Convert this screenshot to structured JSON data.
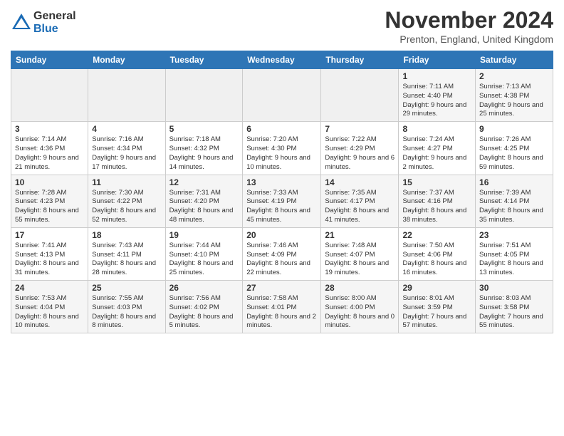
{
  "logo": {
    "general": "General",
    "blue": "Blue"
  },
  "header": {
    "month": "November 2024",
    "location": "Prenton, England, United Kingdom"
  },
  "days_of_week": [
    "Sunday",
    "Monday",
    "Tuesday",
    "Wednesday",
    "Thursday",
    "Friday",
    "Saturday"
  ],
  "weeks": [
    [
      {
        "day": "",
        "info": ""
      },
      {
        "day": "",
        "info": ""
      },
      {
        "day": "",
        "info": ""
      },
      {
        "day": "",
        "info": ""
      },
      {
        "day": "",
        "info": ""
      },
      {
        "day": "1",
        "info": "Sunrise: 7:11 AM\nSunset: 4:40 PM\nDaylight: 9 hours and 29 minutes."
      },
      {
        "day": "2",
        "info": "Sunrise: 7:13 AM\nSunset: 4:38 PM\nDaylight: 9 hours and 25 minutes."
      }
    ],
    [
      {
        "day": "3",
        "info": "Sunrise: 7:14 AM\nSunset: 4:36 PM\nDaylight: 9 hours and 21 minutes."
      },
      {
        "day": "4",
        "info": "Sunrise: 7:16 AM\nSunset: 4:34 PM\nDaylight: 9 hours and 17 minutes."
      },
      {
        "day": "5",
        "info": "Sunrise: 7:18 AM\nSunset: 4:32 PM\nDaylight: 9 hours and 14 minutes."
      },
      {
        "day": "6",
        "info": "Sunrise: 7:20 AM\nSunset: 4:30 PM\nDaylight: 9 hours and 10 minutes."
      },
      {
        "day": "7",
        "info": "Sunrise: 7:22 AM\nSunset: 4:29 PM\nDaylight: 9 hours and 6 minutes."
      },
      {
        "day": "8",
        "info": "Sunrise: 7:24 AM\nSunset: 4:27 PM\nDaylight: 9 hours and 2 minutes."
      },
      {
        "day": "9",
        "info": "Sunrise: 7:26 AM\nSunset: 4:25 PM\nDaylight: 8 hours and 59 minutes."
      }
    ],
    [
      {
        "day": "10",
        "info": "Sunrise: 7:28 AM\nSunset: 4:23 PM\nDaylight: 8 hours and 55 minutes."
      },
      {
        "day": "11",
        "info": "Sunrise: 7:30 AM\nSunset: 4:22 PM\nDaylight: 8 hours and 52 minutes."
      },
      {
        "day": "12",
        "info": "Sunrise: 7:31 AM\nSunset: 4:20 PM\nDaylight: 8 hours and 48 minutes."
      },
      {
        "day": "13",
        "info": "Sunrise: 7:33 AM\nSunset: 4:19 PM\nDaylight: 8 hours and 45 minutes."
      },
      {
        "day": "14",
        "info": "Sunrise: 7:35 AM\nSunset: 4:17 PM\nDaylight: 8 hours and 41 minutes."
      },
      {
        "day": "15",
        "info": "Sunrise: 7:37 AM\nSunset: 4:16 PM\nDaylight: 8 hours and 38 minutes."
      },
      {
        "day": "16",
        "info": "Sunrise: 7:39 AM\nSunset: 4:14 PM\nDaylight: 8 hours and 35 minutes."
      }
    ],
    [
      {
        "day": "17",
        "info": "Sunrise: 7:41 AM\nSunset: 4:13 PM\nDaylight: 8 hours and 31 minutes."
      },
      {
        "day": "18",
        "info": "Sunrise: 7:43 AM\nSunset: 4:11 PM\nDaylight: 8 hours and 28 minutes."
      },
      {
        "day": "19",
        "info": "Sunrise: 7:44 AM\nSunset: 4:10 PM\nDaylight: 8 hours and 25 minutes."
      },
      {
        "day": "20",
        "info": "Sunrise: 7:46 AM\nSunset: 4:09 PM\nDaylight: 8 hours and 22 minutes."
      },
      {
        "day": "21",
        "info": "Sunrise: 7:48 AM\nSunset: 4:07 PM\nDaylight: 8 hours and 19 minutes."
      },
      {
        "day": "22",
        "info": "Sunrise: 7:50 AM\nSunset: 4:06 PM\nDaylight: 8 hours and 16 minutes."
      },
      {
        "day": "23",
        "info": "Sunrise: 7:51 AM\nSunset: 4:05 PM\nDaylight: 8 hours and 13 minutes."
      }
    ],
    [
      {
        "day": "24",
        "info": "Sunrise: 7:53 AM\nSunset: 4:04 PM\nDaylight: 8 hours and 10 minutes."
      },
      {
        "day": "25",
        "info": "Sunrise: 7:55 AM\nSunset: 4:03 PM\nDaylight: 8 hours and 8 minutes."
      },
      {
        "day": "26",
        "info": "Sunrise: 7:56 AM\nSunset: 4:02 PM\nDaylight: 8 hours and 5 minutes."
      },
      {
        "day": "27",
        "info": "Sunrise: 7:58 AM\nSunset: 4:01 PM\nDaylight: 8 hours and 2 minutes."
      },
      {
        "day": "28",
        "info": "Sunrise: 8:00 AM\nSunset: 4:00 PM\nDaylight: 8 hours and 0 minutes."
      },
      {
        "day": "29",
        "info": "Sunrise: 8:01 AM\nSunset: 3:59 PM\nDaylight: 7 hours and 57 minutes."
      },
      {
        "day": "30",
        "info": "Sunrise: 8:03 AM\nSunset: 3:58 PM\nDaylight: 7 hours and 55 minutes."
      }
    ]
  ]
}
